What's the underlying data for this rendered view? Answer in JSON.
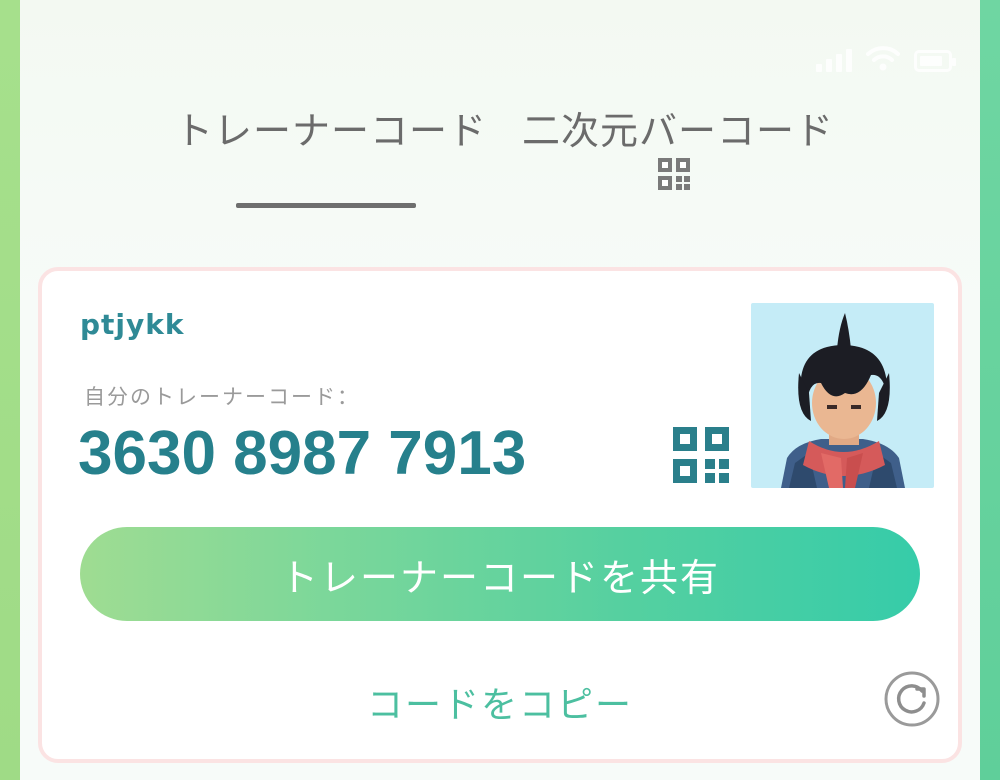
{
  "tabs": {
    "trainer_code": "トレーナーコード",
    "qr_code": "二次元バーコード"
  },
  "card": {
    "username": "ptjykk",
    "code_label": "自分のトレーナーコード：",
    "code_value": "3630 8987 7913",
    "share_button": "トレーナーコードを共有",
    "copy_link": "コードをコピー"
  },
  "icons": {
    "tab_qr": "qr-code-icon",
    "card_qr": "qr-code-icon",
    "refresh": "refresh-icon",
    "signal": "signal-icon",
    "wifi": "wifi-icon",
    "battery": "battery-icon"
  },
  "colors": {
    "accent_teal": "#26808c",
    "button_start": "#9fdc92",
    "button_end": "#36cca9",
    "card_border": "#fbe3e3",
    "tab_text": "#6b6b6b"
  }
}
